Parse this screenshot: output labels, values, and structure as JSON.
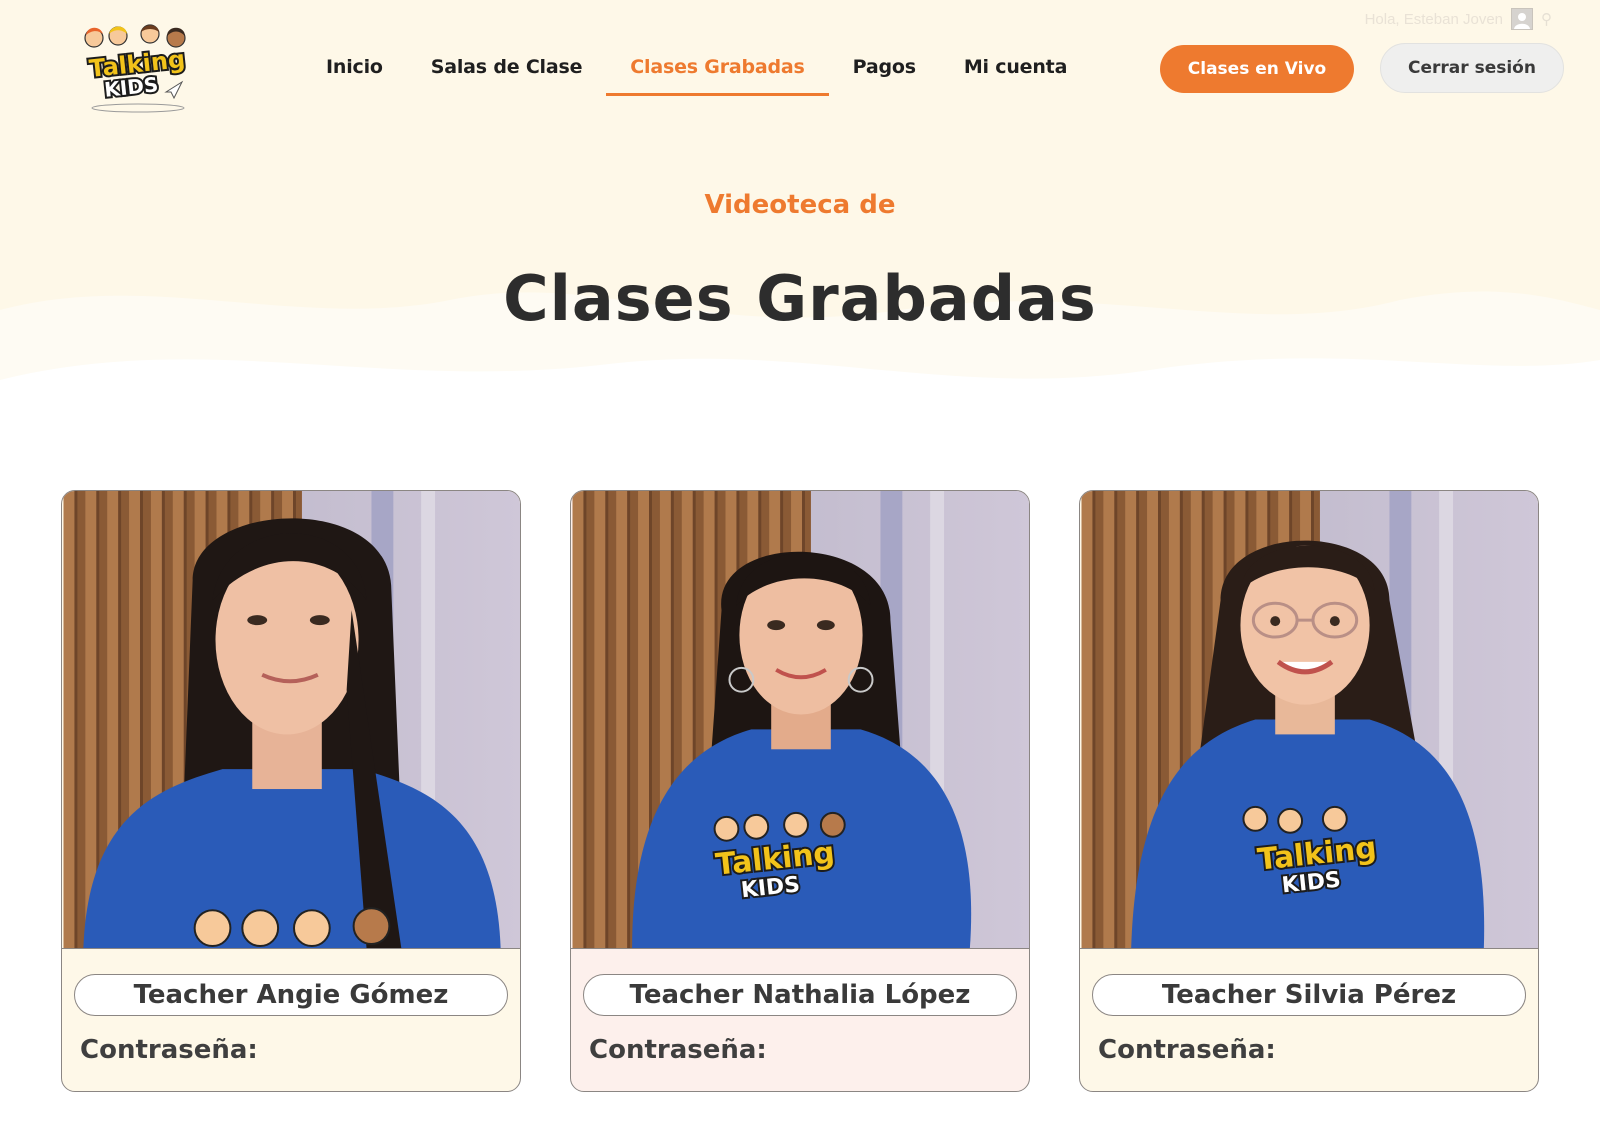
{
  "colors": {
    "accent": "#ee7a2f",
    "hero_background": "#fef8e8",
    "card_background": "#fef8e8",
    "card_background_alt": "#fdf0ec",
    "logout_background": "#efefee",
    "shirt_blue": "#2a5bb8"
  },
  "user": {
    "greeting": "Hola, Esteban Joven",
    "avatar_icon": "user-avatar-icon",
    "search_icon": "search-icon"
  },
  "logo": {
    "text_top": "Talking",
    "text_bottom": "KIDS"
  },
  "nav": {
    "items": [
      {
        "label": "Inicio",
        "active": false
      },
      {
        "label": "Salas de Clase",
        "active": false
      },
      {
        "label": "Clases Grabadas",
        "active": true
      },
      {
        "label": "Pagos",
        "active": false
      },
      {
        "label": "Mi cuenta",
        "active": false
      }
    ],
    "live_button": "Clases en Vivo",
    "logout_button": "Cerrar sesión"
  },
  "hero": {
    "subtitle": "Videoteca de",
    "title": "Clases Grabadas"
  },
  "teachers": [
    {
      "name": "Teacher Angie Gómez",
      "password_label": "Contraseña:"
    },
    {
      "name": "Teacher Nathalia López",
      "password_label": "Contraseña:"
    },
    {
      "name": "Teacher Silvia Pérez",
      "password_label": "Contraseña:"
    }
  ]
}
